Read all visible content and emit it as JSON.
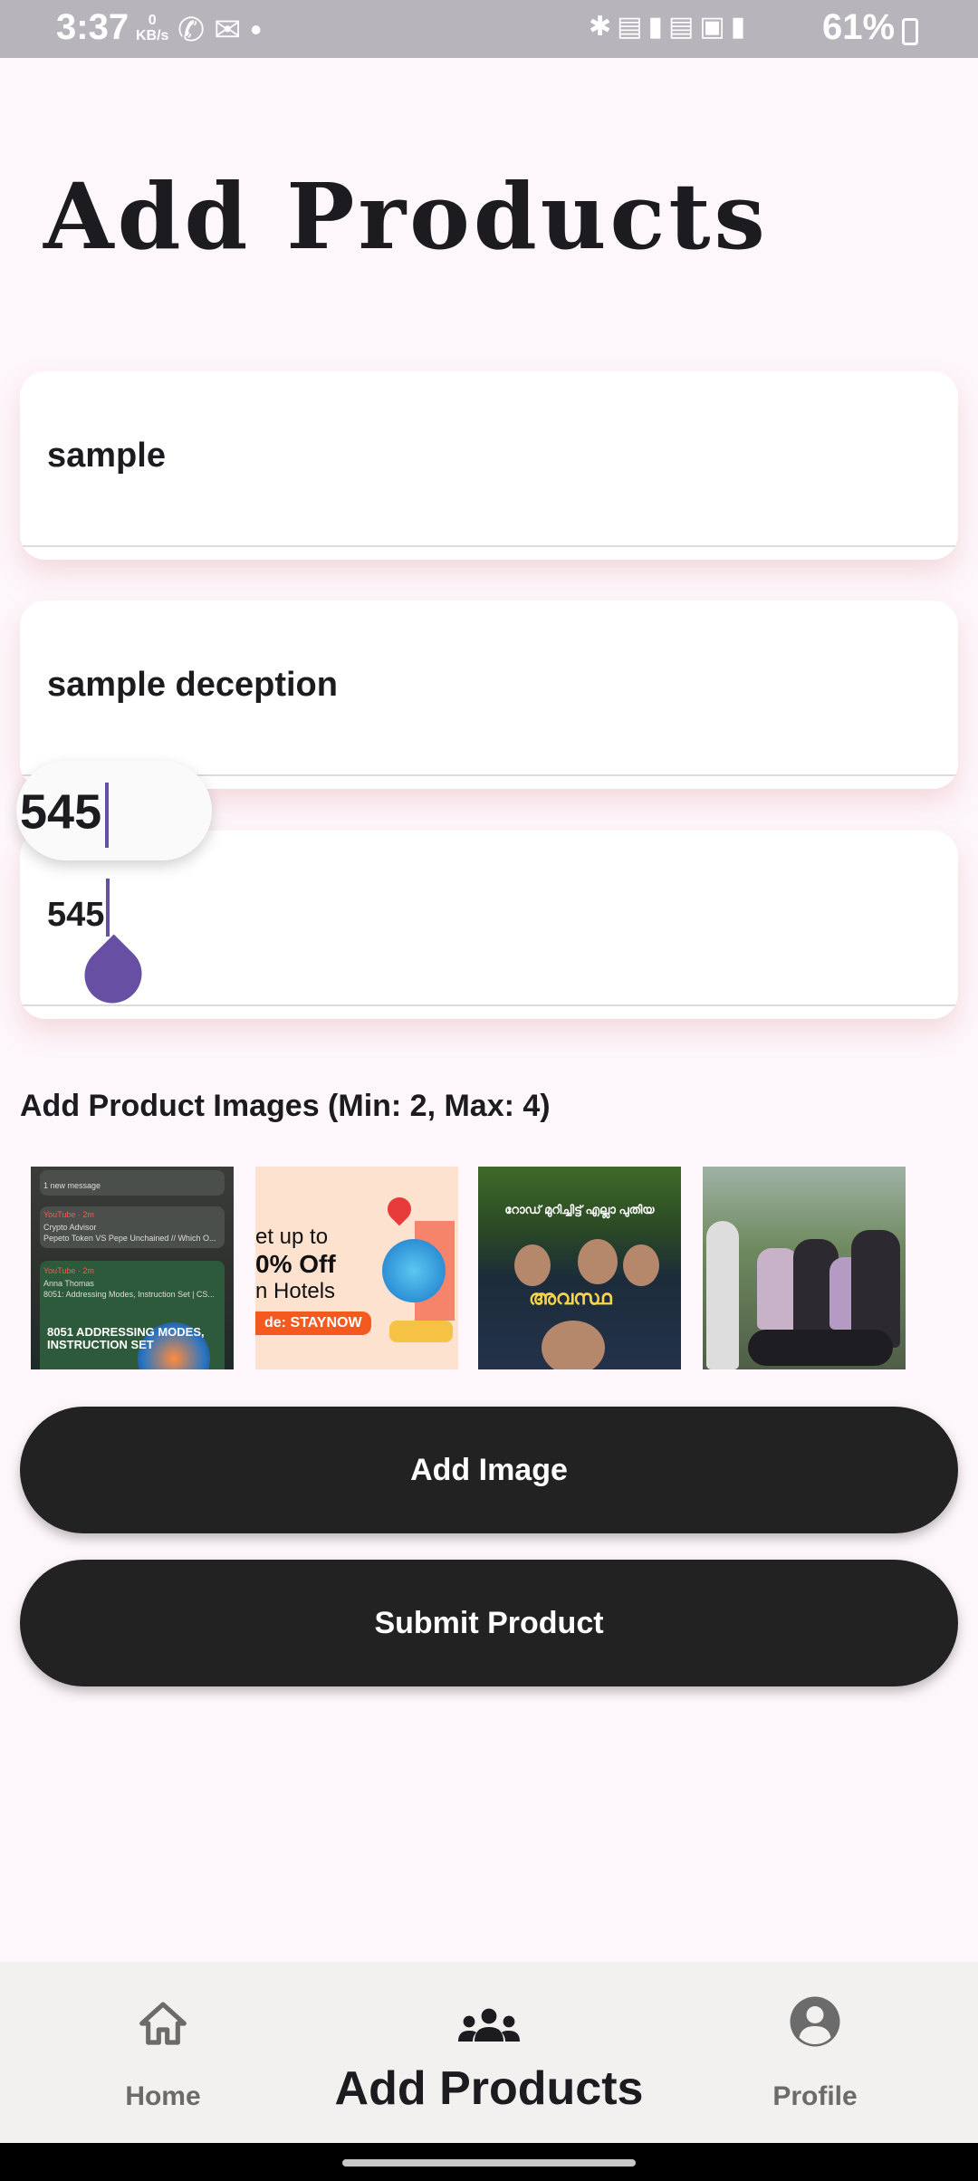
{
  "status_bar": {
    "time": "3:37",
    "net_speed": "0",
    "net_unit": "KB/s",
    "left_icons": [
      "whatsapp-icon",
      "gmail-icon",
      "dot-icon"
    ],
    "right_icons": [
      "bluetooth-icon",
      "volte-lte1-icon",
      "signal-icon",
      "volte-5g2-icon",
      "5g-icon",
      "signal-icon"
    ],
    "battery": "61%"
  },
  "page": {
    "title": "Add Products"
  },
  "form": {
    "name_value": "sample",
    "description_value": "sample deception",
    "price_value": "545",
    "magnifier_value": "545"
  },
  "images": {
    "label": "Add Product Images (Min: 2, Max: 4)",
    "thumb1": {
      "lines": [
        "1 new message",
        "YouTube · 2m",
        "Crypto Advisor",
        "Pepeto Token VS Pepe Unchained // Which O...",
        "YouTube · 2m",
        "Anna Thomas",
        "8051: Addressing Modes, Instruction Set | CS..."
      ],
      "headline": "8051 ADDRESSING MODES, INSTRUCTION SET"
    },
    "thumb2": {
      "line1": "et up to",
      "line2": "0% Off",
      "line3": "n Hotels",
      "code": "de: STAYNOW"
    },
    "thumb3": {
      "top_caption": "റോഡ് മുറിച്ചിട്ട് എല്ലാ പുതിയ",
      "mid_caption": "അവസ്ഥ"
    }
  },
  "buttons": {
    "add_image": "Add Image",
    "submit": "Submit Product"
  },
  "bottom_nav": {
    "home": "Home",
    "add_products": "Add Products",
    "profile": "Profile",
    "active": "add_products"
  },
  "colors": {
    "accent": "#6750a4",
    "button": "#222222",
    "background": "#fdf6fb"
  }
}
